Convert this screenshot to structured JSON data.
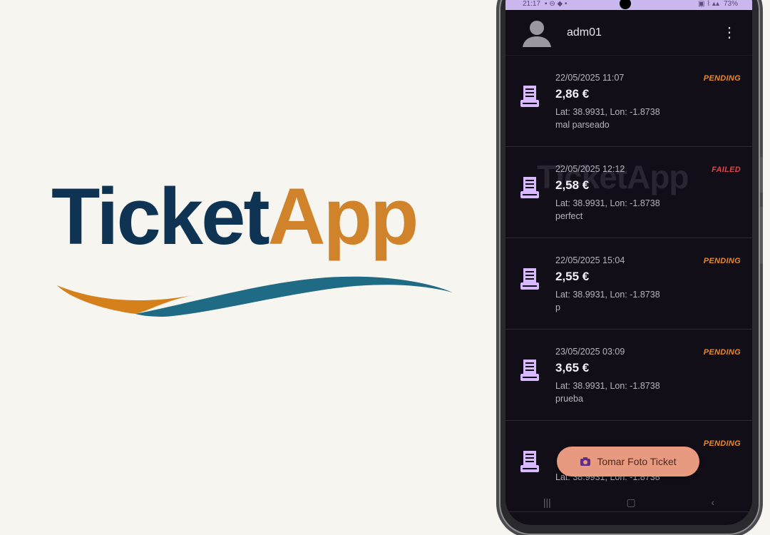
{
  "logo": {
    "part1": "Ticket",
    "part2": "App"
  },
  "status_bar": {
    "time": "21:17",
    "battery": "73%"
  },
  "header": {
    "username": "adm01",
    "menu_icon": "more-vert-icon"
  },
  "watermark": "TicketApp",
  "colors": {
    "logo_dark": "#0f3352",
    "logo_orange": "#d0832a",
    "swoosh_teal": "#1f6a84",
    "pending": "#e68a2e",
    "failed": "#d9464a",
    "accent": "#c9b7ee",
    "fab": "#e89a80"
  },
  "tickets": [
    {
      "date": "22/05/2025 11:07",
      "amount": "2,86 €",
      "coords": "Lat: 38.9931, Lon: -1.8738",
      "note": "mal parseado",
      "status": "PENDING",
      "icon": "receipt-icon"
    },
    {
      "date": "22/05/2025 12:12",
      "amount": "2,58 €",
      "coords": "Lat: 38.9931, Lon: -1.8738",
      "note": "perfect",
      "status": "FAILED",
      "icon": "receipt-icon"
    },
    {
      "date": "22/05/2025 15:04",
      "amount": "2,55 €",
      "coords": "Lat: 38.9931, Lon: -1.8738",
      "note": "p",
      "status": "PENDING",
      "icon": "receipt-icon"
    },
    {
      "date": "23/05/2025 03:09",
      "amount": "3,65 €",
      "coords": "Lat: 38.9931, Lon: -1.8738",
      "note": "prueba",
      "status": "PENDING",
      "icon": "receipt-icon"
    },
    {
      "date": "",
      "amount": "",
      "coords": "Lat: 38.9931, Lon: -1.8738",
      "note": "",
      "status": "PENDING",
      "icon": "receipt-icon"
    }
  ],
  "fab": {
    "label": "Tomar Foto Ticket",
    "icon": "camera-icon"
  }
}
